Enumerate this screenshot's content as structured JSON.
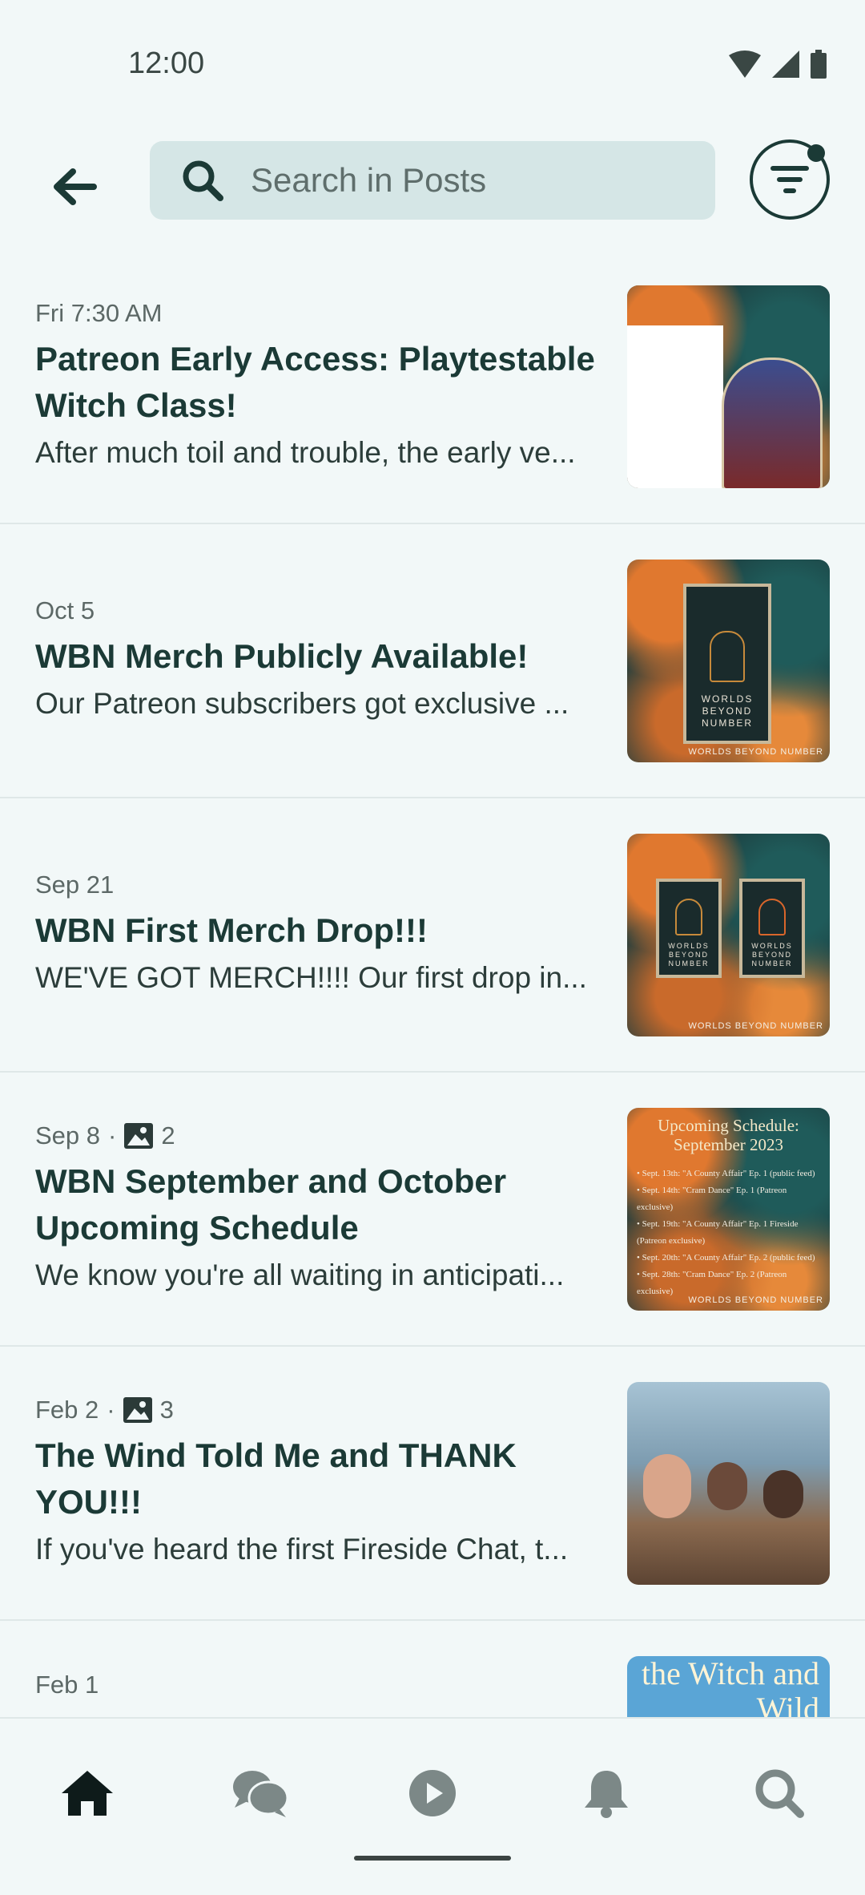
{
  "status_bar": {
    "time": "12:00"
  },
  "search": {
    "placeholder": "Search in Posts"
  },
  "posts": [
    {
      "date": "Fri 7:30 AM",
      "title": "Patreon Early Access: Playtestable Witch Class!",
      "excerpt": "After much toil and trouble, the early ve..."
    },
    {
      "date": "Oct 5",
      "title": "WBN Merch Publicly Available!",
      "excerpt": "Our Patreon subscribers got exclusive ...",
      "thumb_text": "WORLDS BEYOND NUMBER"
    },
    {
      "date": "Sep 21",
      "title": "WBN First Merch Drop!!!",
      "excerpt": "WE'VE GOT MERCH!!!! Our first drop in...",
      "thumb_text": "WORLDS BEYOND NUMBER"
    },
    {
      "date": "Sep 8",
      "image_count": "2",
      "title": "WBN September and October Upcoming Schedule",
      "excerpt": "We know you're all waiting in anticipati...",
      "thumb_title": "Upcoming Schedule: September 2023",
      "thumb_lines": [
        "• Sept. 13th: \"A County Affair\" Ep. 1 (public feed)",
        "• Sept. 14th: \"Cram Dance\" Ep. 1 (Patreon exclusive)",
        "• Sept. 19th: \"A County Affair\" Ep. 1 Fireside (Patreon exclusive)",
        "• Sept. 20th: \"A County Affair\" Ep. 2 (public feed)",
        "• Sept. 28th: \"Cram Dance\" Ep. 2 (Patreon exclusive)"
      ],
      "thumb_text": "WORLDS BEYOND NUMBER"
    },
    {
      "date": "Feb 2",
      "image_count": "3",
      "title": "The Wind Told Me and THANK YOU!!!",
      "excerpt": "If you've heard the first Fireside Chat, t..."
    },
    {
      "date": "Feb 1",
      "title": "",
      "excerpt": "",
      "thumb_text": "the Witch and Wild"
    }
  ],
  "nav": [
    "home-icon",
    "chat-icon",
    "play-icon",
    "bell-icon",
    "search-icon"
  ],
  "colors": {
    "background": "#f2f8f8",
    "text": "#1b3a36",
    "search_bg": "#d5e6e6"
  }
}
